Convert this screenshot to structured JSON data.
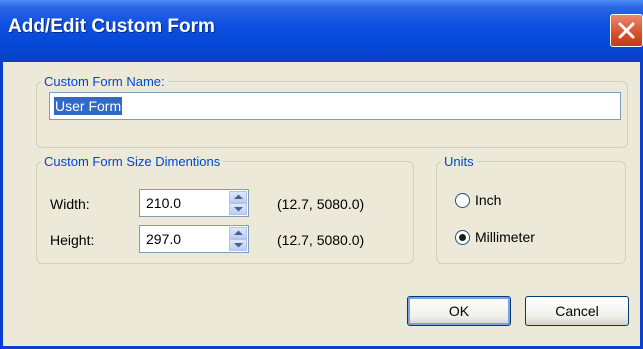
{
  "window": {
    "title": "Add/Edit Custom Form"
  },
  "name_group": {
    "legend": "Custom Form Name:",
    "value": "User Form"
  },
  "size_group": {
    "legend": "Custom Form Size Dimentions",
    "width": {
      "label": "Width:",
      "value": "210.0",
      "range": "(12.7, 5080.0)"
    },
    "height": {
      "label": "Height:",
      "value": "297.0",
      "range": "(12.7, 5080.0)"
    }
  },
  "units_group": {
    "legend": "Units",
    "options": [
      {
        "label": "Inch",
        "checked": false
      },
      {
        "label": "Millimeter",
        "checked": true
      }
    ]
  },
  "buttons": {
    "ok": "OK",
    "cancel": "Cancel"
  }
}
